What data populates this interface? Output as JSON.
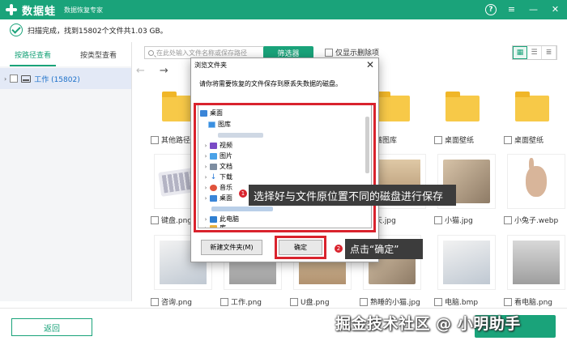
{
  "titlebar": {
    "app_name": "数据蛙",
    "subtitle": "数据恢复专家",
    "help": "?",
    "menu": "≡",
    "minimize": "—",
    "close": "✕"
  },
  "status": {
    "text": "扫描完成，找到15802个文件共1.03 GB。"
  },
  "left_tabs": [
    "按路径查看",
    "按类型查看"
  ],
  "tree": {
    "label": "工作 (15802)"
  },
  "toolbar": {
    "search_placeholder": "在此处输入文件名称或保存路径",
    "filter_label": "筛选器",
    "only_deleted_label": "仅显示删除项"
  },
  "nav": {
    "back": "←",
    "forward": "→"
  },
  "grid": {
    "row1": [
      "其他路径",
      "",
      "",
      "",
      "嘴图库",
      "桌面壁纸",
      "桌面壁纸"
    ],
    "row2": [
      "键盘.png",
      "",
      "",
      "",
      "天.jpg",
      "小猫.jpg",
      "小兔子.webp"
    ],
    "row3": [
      "咨询.png",
      "工作.png",
      "U盘.png",
      "熟睡的小猫.jpg",
      "电脑.bmp",
      "看电脑.png"
    ]
  },
  "dialog": {
    "title": "浏览文件夹",
    "close": "✕",
    "description": "请你将需要恢复的文件保存到原丢失数据的磁盘。",
    "tree": [
      {
        "label": "桌面",
        "icon": "desktop-icon"
      },
      {
        "label": "图库",
        "icon": "picture-icon"
      },
      {
        "label": "视频",
        "icon": "video-icon"
      },
      {
        "label": "图片",
        "icon": "image-icon"
      },
      {
        "label": "文档",
        "icon": "document-icon"
      },
      {
        "label": "下载",
        "icon": "download-icon"
      },
      {
        "label": "音乐",
        "icon": "music-icon"
      },
      {
        "label": "桌面",
        "icon": "desktop-icon"
      },
      {
        "label": "此电脑",
        "icon": "pc-icon"
      },
      {
        "label": "库",
        "icon": "library-icon"
      }
    ],
    "new_folder": "新建文件夹(M)",
    "ok": "确定"
  },
  "callouts": {
    "c1_num": "1",
    "c1_text": "选择好与文件原位置不同的磁盘进行保存",
    "c2_num": "2",
    "c2_text": "点击“确定”"
  },
  "footer": {
    "back_label": "返回"
  },
  "watermark": "掘金技术社区 @ 小明助手",
  "colors": {
    "brand": "#1aa37a",
    "highlight": "#d9232d",
    "callout": "#3c3c3c"
  }
}
